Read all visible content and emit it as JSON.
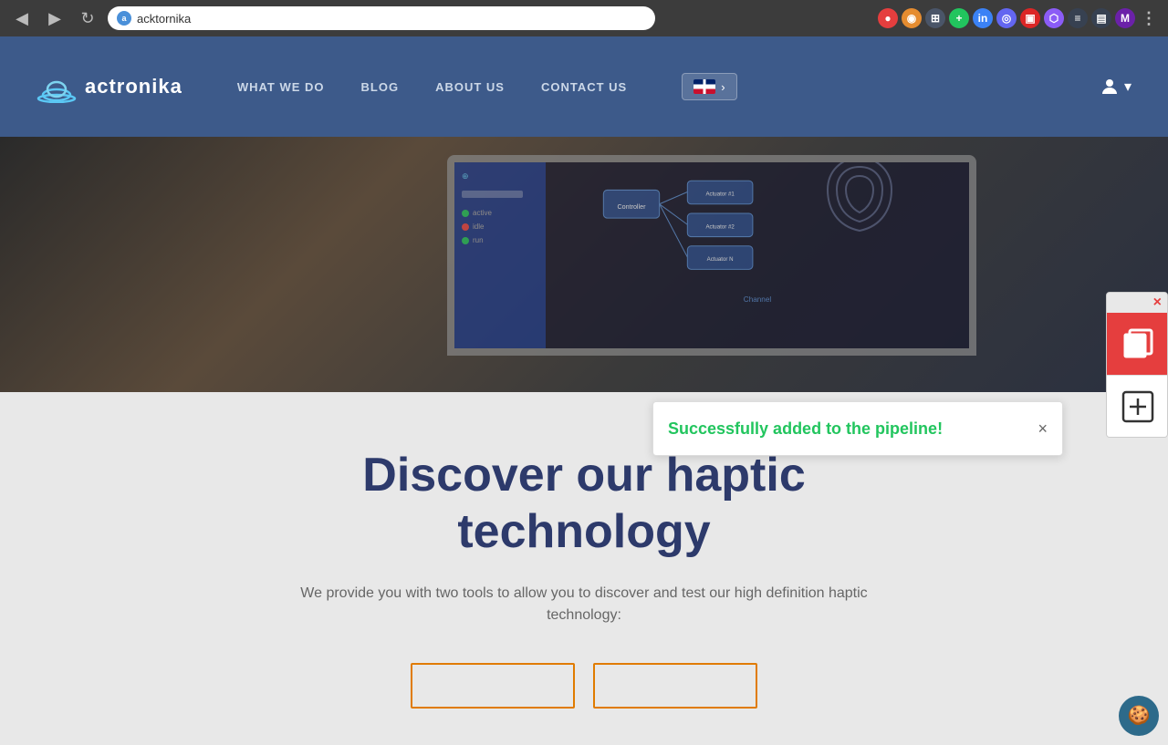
{
  "browser": {
    "url": "acktornika",
    "back_btn": "◀",
    "forward_btn": "▶",
    "refresh_btn": "↻"
  },
  "navbar": {
    "logo_text": "actronika",
    "nav_items": [
      {
        "label": "WHAT WE DO",
        "id": "what-we-do"
      },
      {
        "label": "BLOG",
        "id": "blog"
      },
      {
        "label": "ABOUT US",
        "id": "about-us"
      },
      {
        "label": "CONTACT US",
        "id": "contact-us"
      }
    ],
    "lang_btn_label": "›",
    "user_icon": "👤"
  },
  "hero": {
    "fingerprint_char": "⊕"
  },
  "content": {
    "heading_line1": "Discover our haptic",
    "heading_line2": "technology",
    "subtext": "We provide you with two tools to allow you to discover and test our high definition haptic technology:",
    "cta_btn1": "",
    "cta_btn2": ""
  },
  "toast": {
    "message": "Successfully added to the pipeline!",
    "close_btn": "×"
  },
  "widget": {
    "close_btn": "×",
    "icon_top": "⊟",
    "icon_bottom": "⊞"
  },
  "cookie": {
    "icon": "🍪"
  }
}
